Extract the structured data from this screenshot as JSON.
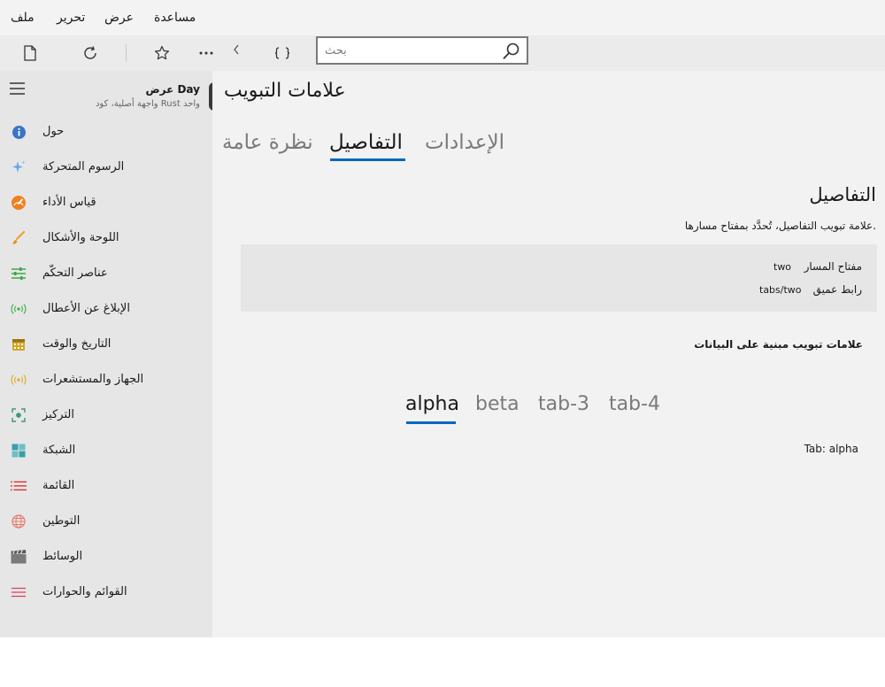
{
  "menu": {
    "file": "ملف",
    "edit": "تحرير",
    "view": "عرض",
    "help": "مساعدة"
  },
  "toolbar": {
    "buttons": [
      "new-document-icon",
      "refresh-icon",
      "star-icon",
      "more-icon",
      "chevron-left-icon",
      "braces-icon"
    ],
    "search_placeholder": "بحث"
  },
  "app": {
    "title": "عرض Day",
    "subtitle": "واجهة أصلية، كود Rust واحد"
  },
  "sidebar": {
    "items": [
      {
        "label": "حول",
        "icon": "info-icon",
        "color": "#3b74c4"
      },
      {
        "label": "الرسوم المتحركة",
        "icon": "sparkles-icon",
        "color": "#6aa7e8"
      },
      {
        "label": "قياس الأداء",
        "icon": "gauge-icon",
        "color": "#f0801e"
      },
      {
        "label": "اللوحة والأشكال",
        "icon": "brush-icon",
        "color": "#f0a030"
      },
      {
        "label": "عناصر التحكّم",
        "icon": "sliders-icon",
        "color": "#3fa54a"
      },
      {
        "label": "الإبلاغ عن الأعطال",
        "icon": "broadcast-icon",
        "color": "#3fb04a"
      },
      {
        "label": "التاريخ والوقت",
        "icon": "calendar-icon",
        "color": "#d4a526"
      },
      {
        "label": "الجهاز والمستشعرات",
        "icon": "sensor-icon",
        "color": "#e0b020"
      },
      {
        "label": "التركيز",
        "icon": "focus-icon",
        "color": "#3a9a70"
      },
      {
        "label": "الشبكة",
        "icon": "grid-icon",
        "color": "#3aa0a8"
      },
      {
        "label": "القائمة",
        "icon": "list-icon",
        "color": "#d63a3a"
      },
      {
        "label": "التوطين",
        "icon": "globe-icon",
        "color": "#e87a6a"
      },
      {
        "label": "الوسائط",
        "icon": "clapperboard-icon",
        "color": "#7a7a7a"
      },
      {
        "label": "القوائم والحوارات",
        "icon": "menu-lines-icon",
        "color": "#d64060"
      }
    ]
  },
  "main": {
    "page_title": "علامات التبويب",
    "tabs": [
      {
        "label": "الإعدادات"
      },
      {
        "label": "التفاصيل"
      },
      {
        "label": "نظرة عامة"
      }
    ],
    "active_tab": "التفاصيل",
    "section_title": "التفاصيل",
    "section_desc": "علامة تبويب التفاصيل، تُحدَّد بمفتاح مسارها.",
    "info": {
      "route_key_label": "مفتاح المسار",
      "route_key_value": "two",
      "deep_link_label": "رابط عميق",
      "deep_link_value": "tabs/two"
    },
    "data_tabs_title": "علامات تبويب مبنية على البيانات",
    "data_tabs": [
      {
        "label": "alpha"
      },
      {
        "label": "beta"
      },
      {
        "label": "tab-3"
      },
      {
        "label": "tab-4"
      }
    ],
    "active_data_tab": "alpha",
    "tab_content": "Tab: alpha",
    "accent_color": "#0067c0"
  }
}
